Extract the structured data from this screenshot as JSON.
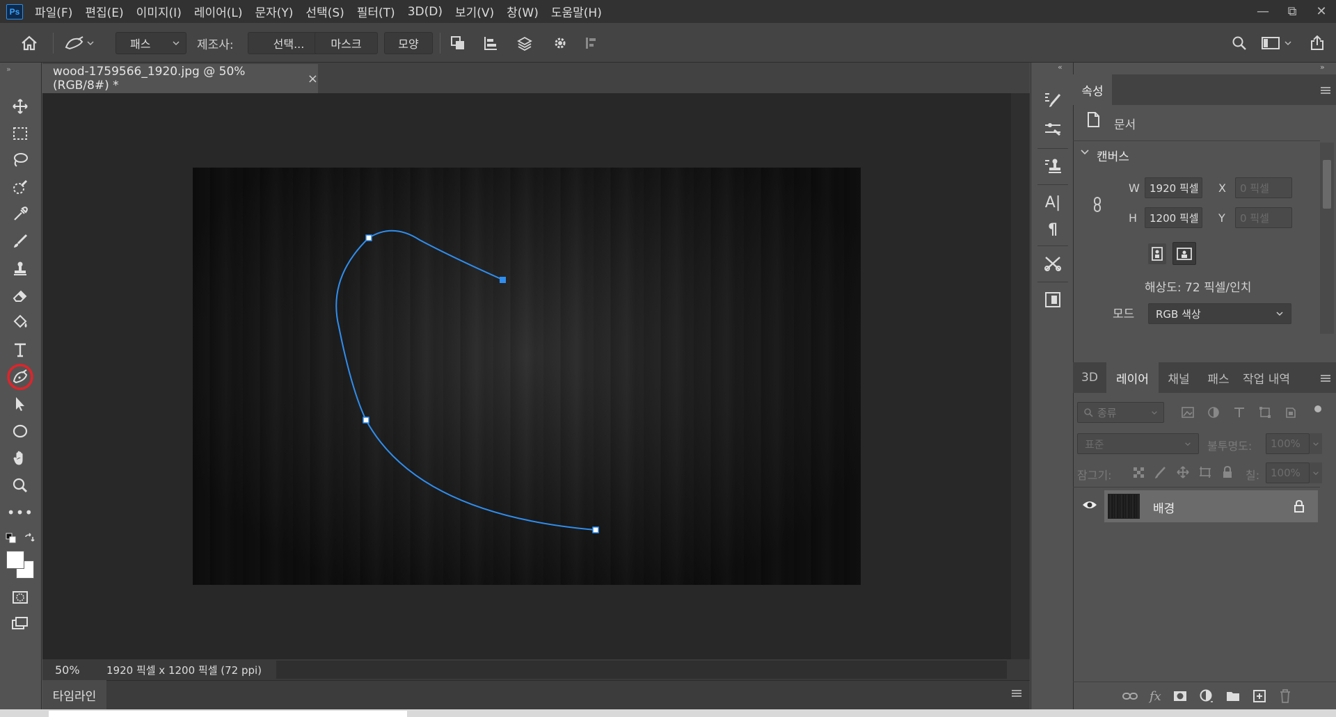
{
  "app": {
    "logo_text": "Ps"
  },
  "menu": {
    "items": [
      "파일(F)",
      "편집(E)",
      "이미지(I)",
      "레이어(L)",
      "문자(Y)",
      "선택(S)",
      "필터(T)",
      "3D(D)",
      "보기(V)",
      "창(W)",
      "도움말(H)"
    ]
  },
  "window_controls": {
    "minimize": "—",
    "restore": "⧉",
    "close": "✕"
  },
  "options_bar": {
    "mode_select": "패스",
    "make_label": "제조사:",
    "selection_button": "선택...",
    "mask_button": "마스크",
    "shape_button": "모양"
  },
  "document": {
    "tab_title": "wood-1759566_1920.jpg @ 50% (RGB/8#) *",
    "tab_close": "×"
  },
  "status_bar": {
    "zoom": "50%",
    "doc_info": "1920 픽셀 x 1200 픽셀 (72 ppi)",
    "arrow": "〉"
  },
  "timeline": {
    "tab_label": "타임라인"
  },
  "properties_panel": {
    "tab_label": "속성",
    "doc_label": "문서",
    "canvas_section": "캔버스",
    "w_label": "W",
    "w_value": "1920 픽셀",
    "h_label": "H",
    "h_value": "1200 픽셀",
    "x_label": "X",
    "x_placeholder": "0 픽셀",
    "y_label": "Y",
    "y_placeholder": "0 픽셀",
    "resolution": "해상도: 72 픽셀/인치",
    "mode_label": "모드",
    "mode_value": "RGB 색상"
  },
  "layers_panel": {
    "tabs": [
      "3D",
      "레이어",
      "채널",
      "패스",
      "작업 내역"
    ],
    "active_tab": "레이어",
    "filter_label": "종류",
    "blend_mode": "표준",
    "opacity_label": "불투명도:",
    "opacity_value": "100%",
    "lock_label": "잠그기:",
    "fill_label": "칠:",
    "fill_value": "100%",
    "layers": [
      {
        "name": "배경",
        "visible": true,
        "locked": true
      }
    ]
  },
  "colors": {
    "path_stroke": "#2f8ef0",
    "highlight_circle": "#e0242a",
    "panel_bg": "#535353",
    "canvas_bg": "#282828"
  }
}
